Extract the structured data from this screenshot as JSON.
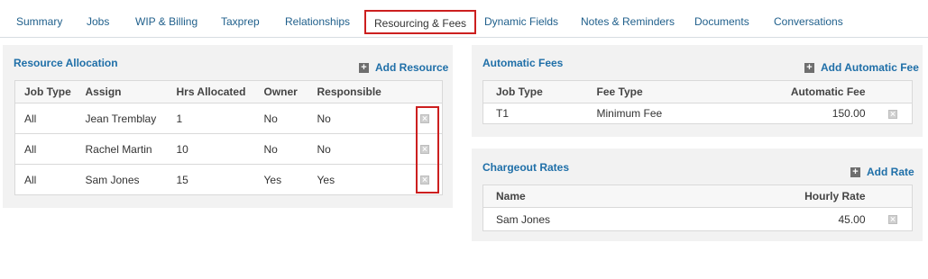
{
  "tabs": [
    {
      "label": "Summary"
    },
    {
      "label": "Jobs"
    },
    {
      "label": "WIP & Billing"
    },
    {
      "label": "Taxprep"
    },
    {
      "label": "Relationships"
    },
    {
      "label": "Resourcing & Fees",
      "active": true
    },
    {
      "label": "Dynamic Fields"
    },
    {
      "label": "Notes & Reminders"
    },
    {
      "label": "Documents"
    },
    {
      "label": "Conversations"
    }
  ],
  "resource_allocation": {
    "title": "Resource Allocation",
    "add_label": "Add Resource",
    "columns": [
      "Job Type",
      "Assign",
      "Hrs Allocated",
      "Owner",
      "Responsible"
    ],
    "rows": [
      {
        "job_type": "All",
        "assign": "Jean Tremblay",
        "hrs": "1",
        "owner": "No",
        "responsible": "No"
      },
      {
        "job_type": "All",
        "assign": "Rachel Martin",
        "hrs": "10",
        "owner": "No",
        "responsible": "No"
      },
      {
        "job_type": "All",
        "assign": "Sam Jones",
        "hrs": "15",
        "owner": "Yes",
        "responsible": "Yes"
      }
    ]
  },
  "automatic_fees": {
    "title": "Automatic Fees",
    "add_label": "Add Automatic Fee",
    "columns": [
      "Job Type",
      "Fee Type",
      "Automatic Fee"
    ],
    "rows": [
      {
        "job_type": "T1",
        "fee_type": "Minimum Fee",
        "fee": "150.00"
      }
    ]
  },
  "chargeout_rates": {
    "title": "Chargeout Rates",
    "add_label": "Add Rate",
    "columns": [
      "Name",
      "Hourly Rate"
    ],
    "rows": [
      {
        "name": "Sam Jones",
        "rate": "45.00"
      }
    ]
  },
  "icons": {
    "add": "plus-icon",
    "delete": "delete-icon"
  },
  "colors": {
    "link": "#1f6fa8",
    "highlight": "#cc1f1f",
    "panel_bg": "#f2f2f2"
  }
}
